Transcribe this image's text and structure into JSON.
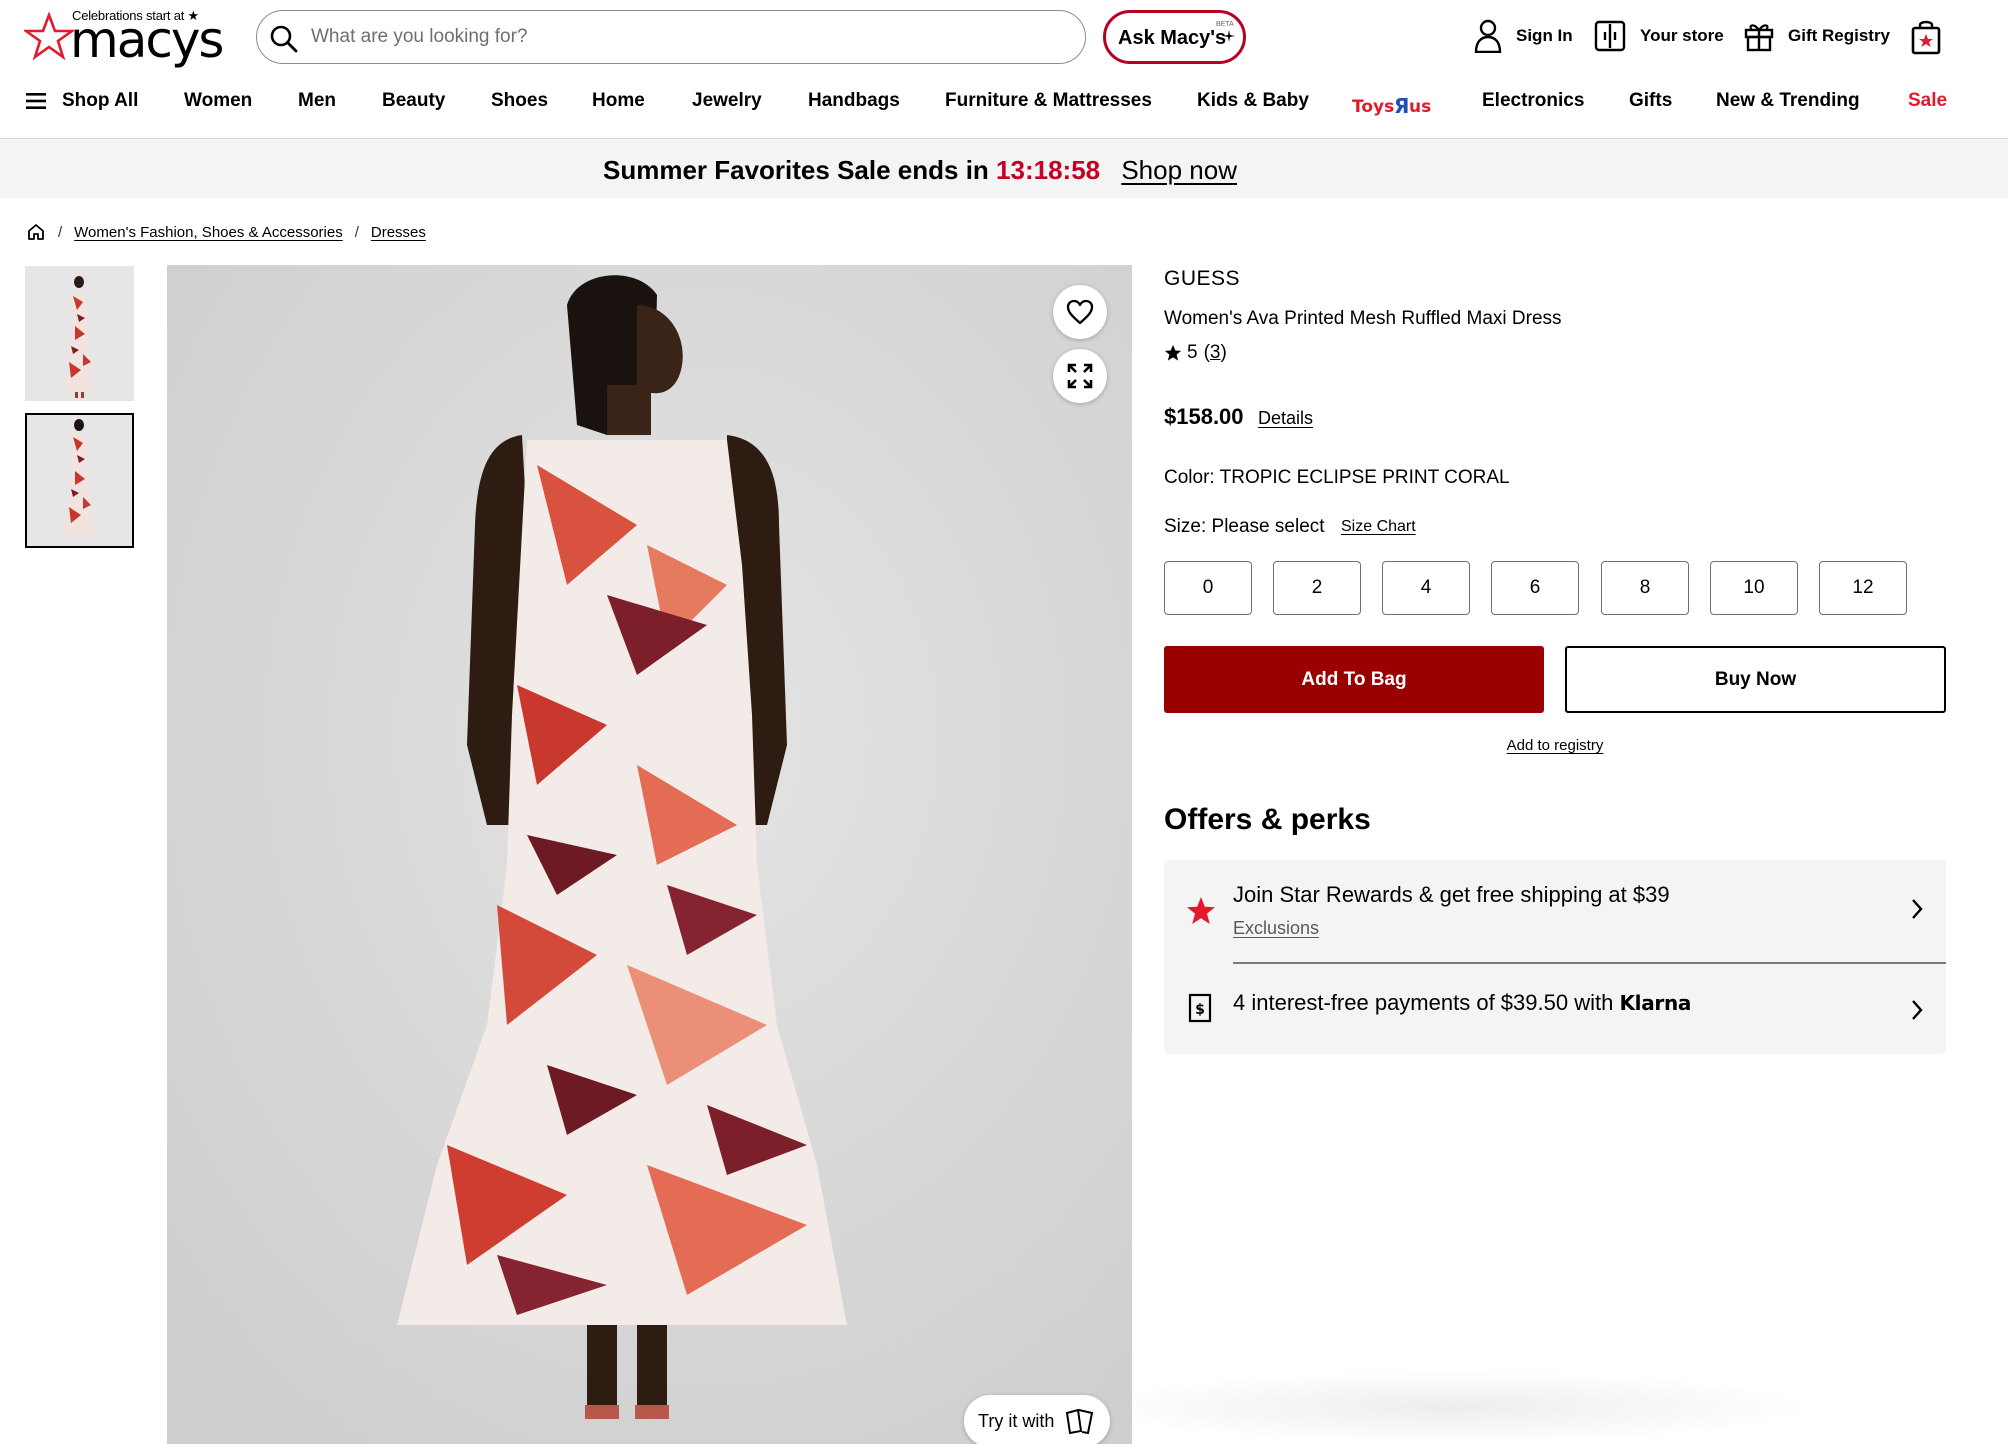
{
  "header": {
    "logo_tagline": "Celebrations start at ★",
    "logo_word": "macys",
    "search_placeholder": "What are you looking for?",
    "ask_label": "Ask Macy's",
    "ask_badge": "BETA",
    "sign_in": "Sign In",
    "your_store": "Your store",
    "gift_registry": "Gift Registry"
  },
  "nav": {
    "shop_all": "Shop All",
    "items": [
      "Women",
      "Men",
      "Beauty",
      "Shoes",
      "Home",
      "Jewelry",
      "Handbags",
      "Furniture & Mattresses",
      "Kids & Baby",
      "Toys\"R\"Us",
      "Electronics",
      "Gifts",
      "New & Trending",
      "Sale"
    ],
    "sale_color": "#e21a2c"
  },
  "promo": {
    "text": "Summer Favorites Sale ends in",
    "timer": "13:18:58",
    "link": "Shop now"
  },
  "breadcrumb": {
    "items": [
      "Women's Fashion, Shoes & Accessories",
      "Dresses"
    ]
  },
  "product": {
    "brand": "GUESS",
    "name": "Women's Ava Printed Mesh Ruffled Maxi Dress",
    "rating": "5",
    "review_count": "3",
    "price": "$158.00",
    "price_details": "Details",
    "color_label": "Color:",
    "color_value": "TROPIC ECLIPSE PRINT CORAL",
    "size_label": "Size:",
    "size_value": "Please select",
    "size_chart": "Size Chart",
    "sizes": [
      "0",
      "2",
      "4",
      "6",
      "8",
      "10",
      "12"
    ],
    "add_to_bag": "Add To Bag",
    "buy_now": "Buy Now",
    "add_to_registry": "Add to registry",
    "try_it_with": "Try it with"
  },
  "offers": {
    "title": "Offers & perks",
    "star_rewards": "Join Star Rewards & get free shipping at $39",
    "exclusions": "Exclusions",
    "klarna_text": "4 interest-free payments of $39.50 with",
    "klarna_brand": "Klarna"
  },
  "colors": {
    "brand_red": "#e21a2c",
    "bag_button": "#9b0000",
    "ask_border": "#b80021",
    "timer": "#c40024"
  }
}
